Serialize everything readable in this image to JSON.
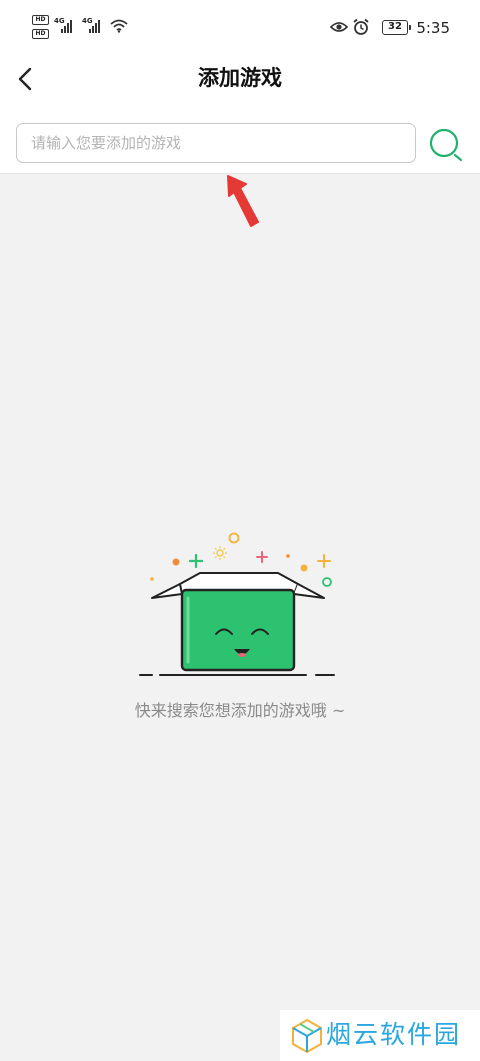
{
  "status_bar": {
    "sim1_badge": "HD",
    "sim2_badge": "HD",
    "network1": "4G",
    "network2": "4G",
    "battery_level": "32",
    "time": "5:35",
    "icons": [
      "signal-icon",
      "wifi-icon",
      "eye-icon",
      "alarm-icon",
      "battery-icon"
    ]
  },
  "header": {
    "back_icon": "chevron-left-icon",
    "title": "添加游戏"
  },
  "search": {
    "placeholder": "请输入您要添加的游戏",
    "value": "",
    "button_icon": "search-icon",
    "accent_color": "#21b36b"
  },
  "empty_state": {
    "illustration": "smiling-green-box",
    "message": "快来搜索您想添加的游戏哦 ~",
    "box_color": "#2cc26f"
  },
  "watermark": {
    "text": "烟云软件园",
    "color": "#2aa7de"
  },
  "annotation": {
    "arrow_color": "#e53935"
  }
}
